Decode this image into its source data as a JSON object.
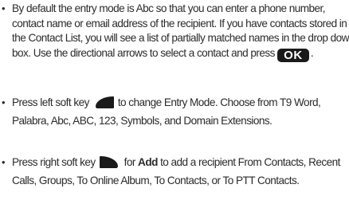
{
  "bullets": {
    "item1": {
      "text": "By default the entry mode is Abc so that you can enter a phone number, contact name or email address of the recipient. If you have contacts stored in the Contact List, you will see a list of partially matched names in the drop down box. Use the directional arrows to select a contact and press",
      "ok_label": "OK",
      "suffix": "."
    },
    "item2": {
      "pre": "Press left soft key",
      "post": "to change Entry Mode. Choose from T9 Word, Palabra, Abc, ABC, 123, Symbols, and Domain Extensions.",
      "icon": "left-soft-key-icon"
    },
    "item3": {
      "pre": "Press right soft key",
      "mid": "for",
      "bold": "Add",
      "post": "to add a recipient From Contacts, Recent Calls, Groups, To Online Album, To Contacts, or To PTT Contacts.",
      "icon": "right-soft-key-icon"
    }
  }
}
